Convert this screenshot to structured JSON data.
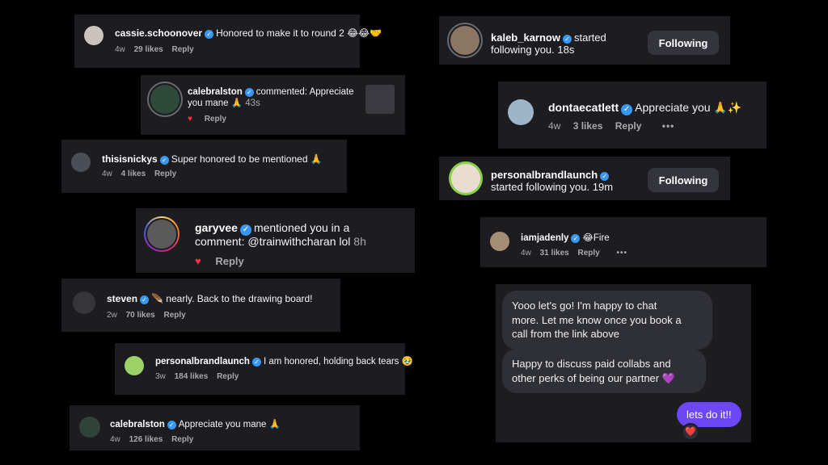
{
  "colors": {
    "background": "#000000",
    "card": "#1c1c21",
    "verified": "#3897f0",
    "heart": "#ff3040",
    "outgoing_bubble": "#6c47f5",
    "follow_button": "#34343c"
  },
  "comments": {
    "cassie": {
      "username": "cassie.schoonover",
      "text": "Honored to make it to round 2 😂😂🤝",
      "time": "4w",
      "likes": "29 likes",
      "reply": "Reply"
    },
    "calebralston_notif": {
      "username": "calebralston",
      "text": "commented: Appreciate",
      "text2": "you mane 🙏",
      "time": "43s",
      "reply": "Reply"
    },
    "thisisnickys": {
      "username": "thisisnickys",
      "text": "Super honored to be mentioned 🙏",
      "time": "4w",
      "likes": "4 likes",
      "reply": "Reply"
    },
    "garyvee": {
      "username": "garyvee",
      "text": "mentioned you in a",
      "text2": "comment: @trainwithcharan lol",
      "time": "8h",
      "reply": "Reply"
    },
    "steven": {
      "username": "steven",
      "text": "🪶 nearly. Back to the drawing board!",
      "time": "2w",
      "likes": "70 likes",
      "reply": "Reply"
    },
    "personalbrand_comment": {
      "username": "personalbrandlaunch",
      "text": "I am honored, holding back tears 🥹",
      "time": "3w",
      "likes": "184 likes",
      "reply": "Reply"
    },
    "calebralston_comment": {
      "username": "calebralston",
      "text": "Appreciate you mane 🙏",
      "time": "4w",
      "likes": "126 likes",
      "reply": "Reply"
    },
    "donte": {
      "username": "dontaecatlett",
      "text": "Appreciate you 🙏✨",
      "time": "4w",
      "likes": "3 likes",
      "reply": "Reply",
      "more": "•••"
    },
    "iamjadenly": {
      "username": "iamjadenly",
      "text": "😂Fire",
      "time": "4w",
      "likes": "31 likes",
      "reply": "Reply",
      "more": "•••"
    }
  },
  "follows": {
    "kaleb": {
      "username": "kaleb_karnow",
      "text": "started",
      "text2": "following you.",
      "time": "18s",
      "button": "Following"
    },
    "personalbrand": {
      "username": "personalbrandlaunch",
      "text2": "started following you.",
      "time": "19m",
      "button": "Following"
    }
  },
  "dm": {
    "msg1": [
      "Yooo let's go! I'm happy to chat",
      "more. Let me know once you book a",
      "call from the link above"
    ],
    "msg2": [
      "Happy to discuss paid collabs and",
      "other perks of being our partner 💜"
    ],
    "reply": "lets do it!!",
    "reaction": "❤️"
  }
}
